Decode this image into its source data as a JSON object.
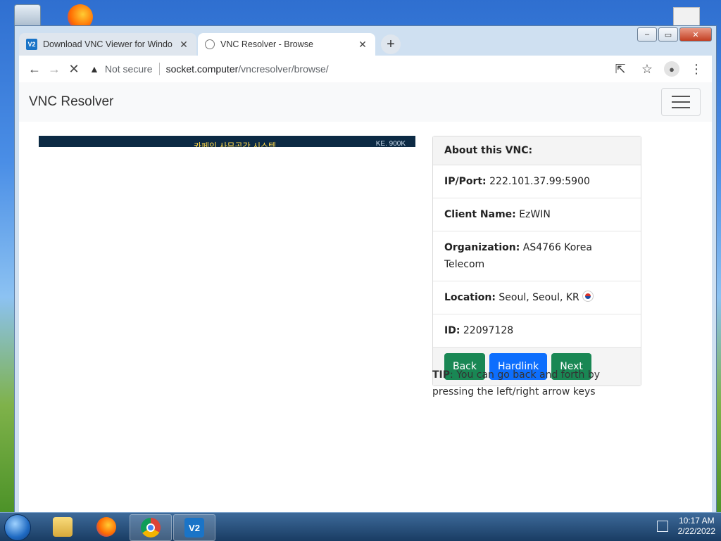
{
  "desktop": {
    "icons": [
      "recycle-bin-icon",
      "firefox-icon",
      "document-icon"
    ]
  },
  "window": {
    "controls": {
      "minimize": "–",
      "maximize": "▭",
      "close": "✕"
    }
  },
  "tabs": [
    {
      "title": "Download VNC Viewer for Windo",
      "favicon": "V2",
      "active": false
    },
    {
      "title": "VNC Resolver - Browse",
      "active": true
    }
  ],
  "tab_close_glyph": "✕",
  "newtab_glyph": "+",
  "toolbar": {
    "back_glyph": "←",
    "forward_glyph": "→",
    "stop_glyph": "✕",
    "security_label": "Not secure",
    "url_host": "socket.computer",
    "url_path": "/vncresolver/browse/",
    "share_glyph": "⇱",
    "star_glyph": "☆",
    "menu_glyph": "⋮"
  },
  "page": {
    "brand": "VNC Resolver",
    "screenshot": {
      "caption_left": "카페인 사무공간 시스템",
      "caption_right": "KE. 900K"
    },
    "card": {
      "header": "About this VNC:",
      "rows": [
        {
          "label": "IP/Port:",
          "value": "222.101.37.99:5900"
        },
        {
          "label": "Client Name:",
          "value": "EzWIN"
        },
        {
          "label": "Organization:",
          "value": "AS4766 Korea Telecom"
        },
        {
          "label": "Location:",
          "value": "Seoul, Seoul, KR"
        },
        {
          "label": "ID:",
          "value": "22097128"
        }
      ],
      "buttons": {
        "back": "Back",
        "hardlink": "Hardlink",
        "next": "Next"
      }
    },
    "tip_label": "TIP",
    "tip_text": ": You can go back and forth by pressing the left/right arrow keys"
  },
  "taskbar": {
    "apps": [
      "folder-icon",
      "firefox-icon",
      "chrome-icon",
      "vnc-viewer-icon"
    ],
    "vnc_glyph": "V2",
    "clock_time": "10:17 AM",
    "clock_date": "2/22/2022"
  },
  "colors": {
    "btn_green": "#198754",
    "btn_blue": "#0d6efd",
    "navbar_bg": "#f8f9fa"
  }
}
